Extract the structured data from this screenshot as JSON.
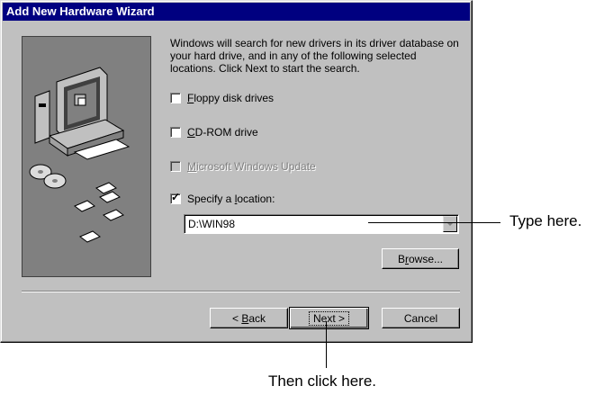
{
  "window": {
    "title": "Add New Hardware Wizard"
  },
  "description": "Windows will search for new drivers in its driver database on your hard drive, and in any of the following selected locations. Click Next to start the search.",
  "options": [
    {
      "label_pre": "",
      "accel": "F",
      "label_post": "loppy disk drives",
      "checked": false,
      "enabled": true
    },
    {
      "label_pre": "",
      "accel": "C",
      "label_post": "D-ROM drive",
      "checked": false,
      "enabled": true
    },
    {
      "label_pre": "",
      "accel": "M",
      "label_post": "icrosoft Windows Update",
      "checked": false,
      "enabled": false
    },
    {
      "label_pre": "Specify a ",
      "accel": "l",
      "label_post": "ocation:",
      "checked": true,
      "enabled": true
    }
  ],
  "location": {
    "value": "D:\\WIN98"
  },
  "buttons": {
    "browse": {
      "pre": "B",
      "accel": "r",
      "post": "owse..."
    },
    "back": {
      "pre": "< ",
      "accel": "B",
      "post": "ack"
    },
    "next": {
      "label": "Next >"
    },
    "cancel": {
      "label": "Cancel"
    }
  },
  "annotations": {
    "type_here": "Type here.",
    "click_here": "Then click here."
  }
}
